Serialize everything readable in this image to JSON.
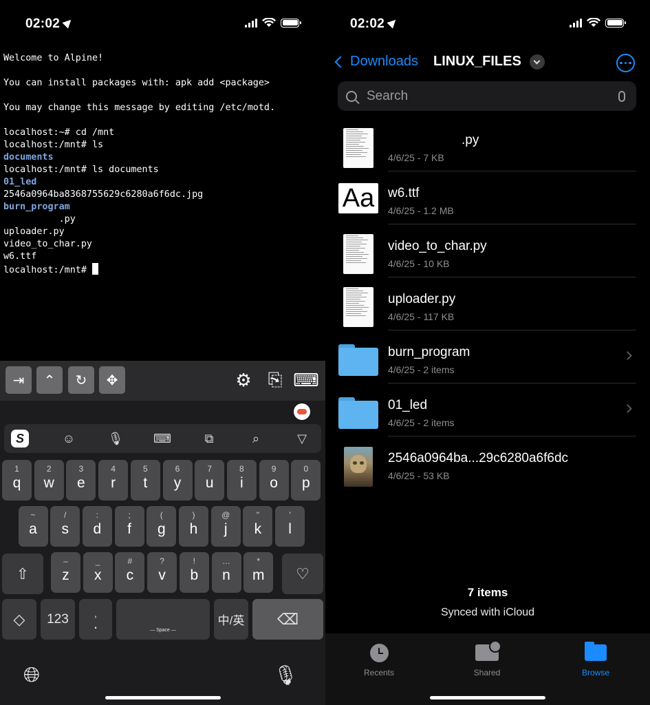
{
  "left_status": {
    "time": "02:02"
  },
  "right_status": {
    "time": "02:02"
  },
  "terminal": {
    "lines": [
      {
        "text": "Welcome to Alpine!",
        "type": "text"
      },
      {
        "text": "",
        "type": "text"
      },
      {
        "text": "You can install packages with: apk add <package>",
        "type": "text"
      },
      {
        "text": "",
        "type": "text"
      },
      {
        "text": "You may change this message by editing /etc/motd.",
        "type": "text"
      },
      {
        "text": "",
        "type": "text"
      },
      {
        "text": "localhost:~# cd /mnt",
        "type": "text"
      },
      {
        "text": "localhost:/mnt# ls",
        "type": "text"
      },
      {
        "text": "documents",
        "type": "dir"
      },
      {
        "text": "localhost:/mnt# ls documents",
        "type": "text"
      },
      {
        "text": "01_led",
        "type": "dir"
      },
      {
        "text": "2546a0964ba8368755629c6280a6f6dc.jpg",
        "type": "text"
      },
      {
        "text": "burn_program",
        "type": "dir"
      },
      {
        "text": "          .py",
        "type": "text"
      },
      {
        "text": "uploader.py",
        "type": "text"
      },
      {
        "text": "video_to_char.py",
        "type": "text"
      },
      {
        "text": "w6.ttf",
        "type": "text"
      }
    ],
    "prompt": "localhost:/mnt# "
  },
  "keyboard": {
    "rows": [
      [
        {
          "sub": "1",
          "main": "q"
        },
        {
          "sub": "2",
          "main": "w"
        },
        {
          "sub": "3",
          "main": "e"
        },
        {
          "sub": "4",
          "main": "r"
        },
        {
          "sub": "5",
          "main": "t"
        },
        {
          "sub": "6",
          "main": "y"
        },
        {
          "sub": "7",
          "main": "u"
        },
        {
          "sub": "8",
          "main": "i"
        },
        {
          "sub": "9",
          "main": "o"
        },
        {
          "sub": "0",
          "main": "p"
        }
      ],
      [
        {
          "sub": "~",
          "main": "a"
        },
        {
          "sub": "/",
          "main": "s"
        },
        {
          "sub": ":",
          "main": "d"
        },
        {
          "sub": ";",
          "main": "f"
        },
        {
          "sub": "(",
          "main": "g"
        },
        {
          "sub": ")",
          "main": "h"
        },
        {
          "sub": "@",
          "main": "j"
        },
        {
          "sub": "\"",
          "main": "k"
        },
        {
          "sub": "'",
          "main": "l"
        }
      ],
      [
        {
          "sub": "–",
          "main": "z"
        },
        {
          "sub": "_",
          "main": "x"
        },
        {
          "sub": "#",
          "main": "c"
        },
        {
          "sub": "?",
          "main": "v"
        },
        {
          "sub": "!",
          "main": "b"
        },
        {
          "sub": "…",
          "main": "n"
        },
        {
          "sub": "*",
          "main": "m"
        }
      ]
    ],
    "num_label": "123",
    "comma_label": ",",
    "period_label": ".",
    "space_label": "— Space —",
    "lang_label": "中/英"
  },
  "files": {
    "back_label": "Downloads",
    "title": "LINUX_FILES",
    "search_placeholder": "Search",
    "items": [
      {
        "name": ".py",
        "meta": "4/6/25 - 7 KB",
        "kind": "doc"
      },
      {
        "name": "w6.ttf",
        "meta": "4/6/25 - 1.2 MB",
        "kind": "font"
      },
      {
        "name": "video_to_char.py",
        "meta": "4/6/25 - 10 KB",
        "kind": "doc"
      },
      {
        "name": "uploader.py",
        "meta": "4/6/25 - 117 KB",
        "kind": "doc"
      },
      {
        "name": "burn_program",
        "meta": "4/6/25 - 2 items",
        "kind": "folder"
      },
      {
        "name": "01_led",
        "meta": "4/6/25 - 2 items",
        "kind": "folder"
      },
      {
        "name": "2546a0964ba...29c6280a6f6dc",
        "meta": "4/6/25 - 53 KB",
        "kind": "image"
      }
    ],
    "font_thumb_label": "Aa",
    "count_label": "7 items",
    "sync_label": "Synced with iCloud",
    "tabs": [
      {
        "label": "Recents",
        "icon": "clock-icon",
        "active": false
      },
      {
        "label": "Shared",
        "icon": "shared-folder-icon",
        "active": false
      },
      {
        "label": "Browse",
        "icon": "folder-icon",
        "active": true
      }
    ],
    "accent_color": "#1a8cff"
  }
}
